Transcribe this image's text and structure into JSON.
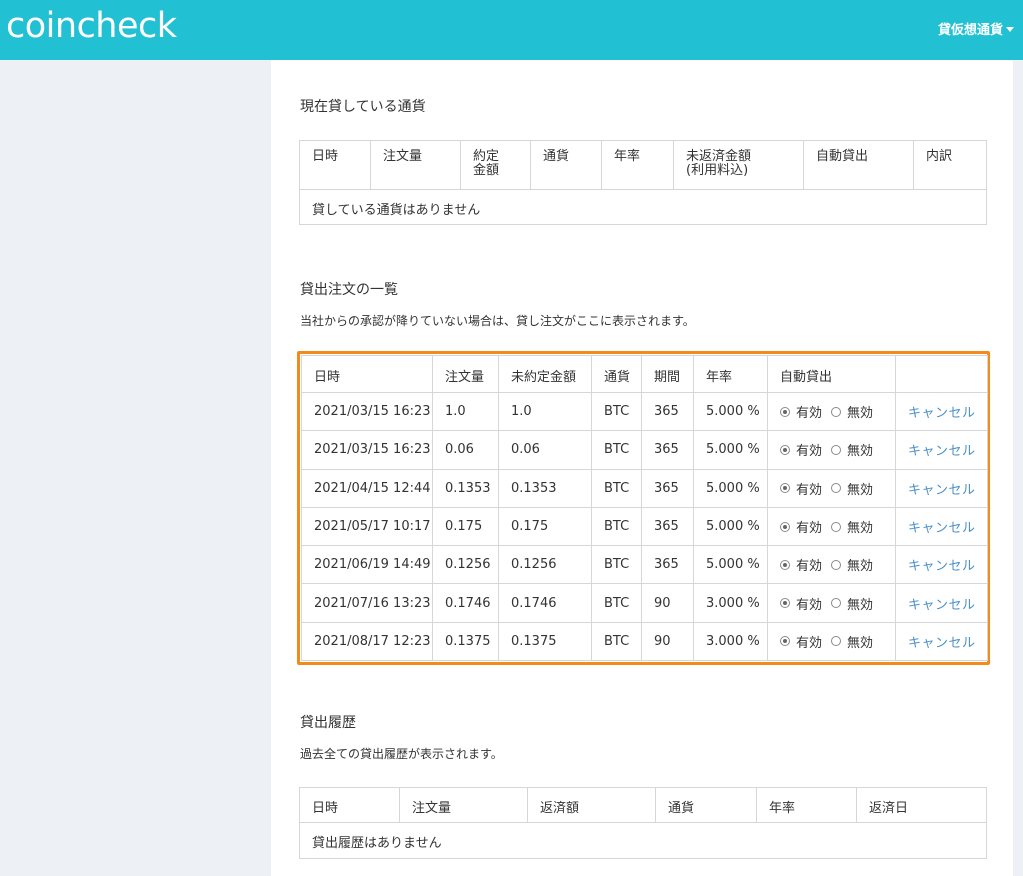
{
  "header": {
    "logo": "coincheck",
    "menu_label": "貸仮想通貨"
  },
  "lent_section": {
    "title": "現在貸している通貨",
    "columns": [
      "日時",
      "注文量",
      "約定\n金額",
      "通貨",
      "年率",
      "未返済金額\n(利用料込)",
      "自動貸出",
      "内訳"
    ],
    "empty_message": "貸している通貨はありません"
  },
  "orders_section": {
    "title": "貸出注文の一覧",
    "description": "当社からの承認が降りていない場合は、貸し注文がここに表示されます。",
    "columns": [
      "日時",
      "注文量",
      "未約定金額",
      "通貨",
      "期間",
      "年率",
      "自動貸出",
      ""
    ],
    "radio_on_label": "有効",
    "radio_off_label": "無効",
    "cancel_label": "キャンセル",
    "rows": [
      {
        "datetime": "2021/03/15 16:23",
        "amount": "1.0",
        "unfilled": "1.0",
        "currency": "BTC",
        "period": "365",
        "rate": "5.000 %"
      },
      {
        "datetime": "2021/03/15 16:23",
        "amount": "0.06",
        "unfilled": "0.06",
        "currency": "BTC",
        "period": "365",
        "rate": "5.000 %"
      },
      {
        "datetime": "2021/04/15 12:44",
        "amount": "0.1353",
        "unfilled": "0.1353",
        "currency": "BTC",
        "period": "365",
        "rate": "5.000 %"
      },
      {
        "datetime": "2021/05/17 10:17",
        "amount": "0.175",
        "unfilled": "0.175",
        "currency": "BTC",
        "period": "365",
        "rate": "5.000 %"
      },
      {
        "datetime": "2021/06/19 14:49",
        "amount": "0.1256",
        "unfilled": "0.1256",
        "currency": "BTC",
        "period": "365",
        "rate": "5.000 %"
      },
      {
        "datetime": "2021/07/16 13:23",
        "amount": "0.1746",
        "unfilled": "0.1746",
        "currency": "BTC",
        "period": "90",
        "rate": "3.000 %"
      },
      {
        "datetime": "2021/08/17 12:23",
        "amount": "0.1375",
        "unfilled": "0.1375",
        "currency": "BTC",
        "period": "90",
        "rate": "3.000 %"
      }
    ]
  },
  "history_section": {
    "title": "貸出履歴",
    "description": "過去全ての貸出履歴が表示されます。",
    "columns": [
      "日時",
      "注文量",
      "返済額",
      "通貨",
      "年率",
      "返済日"
    ],
    "empty_message": "貸出履歴はありません"
  },
  "colors": {
    "header_bg": "#21c1d3",
    "highlight_border": "#f28b1a",
    "link": "#4a90c8"
  }
}
